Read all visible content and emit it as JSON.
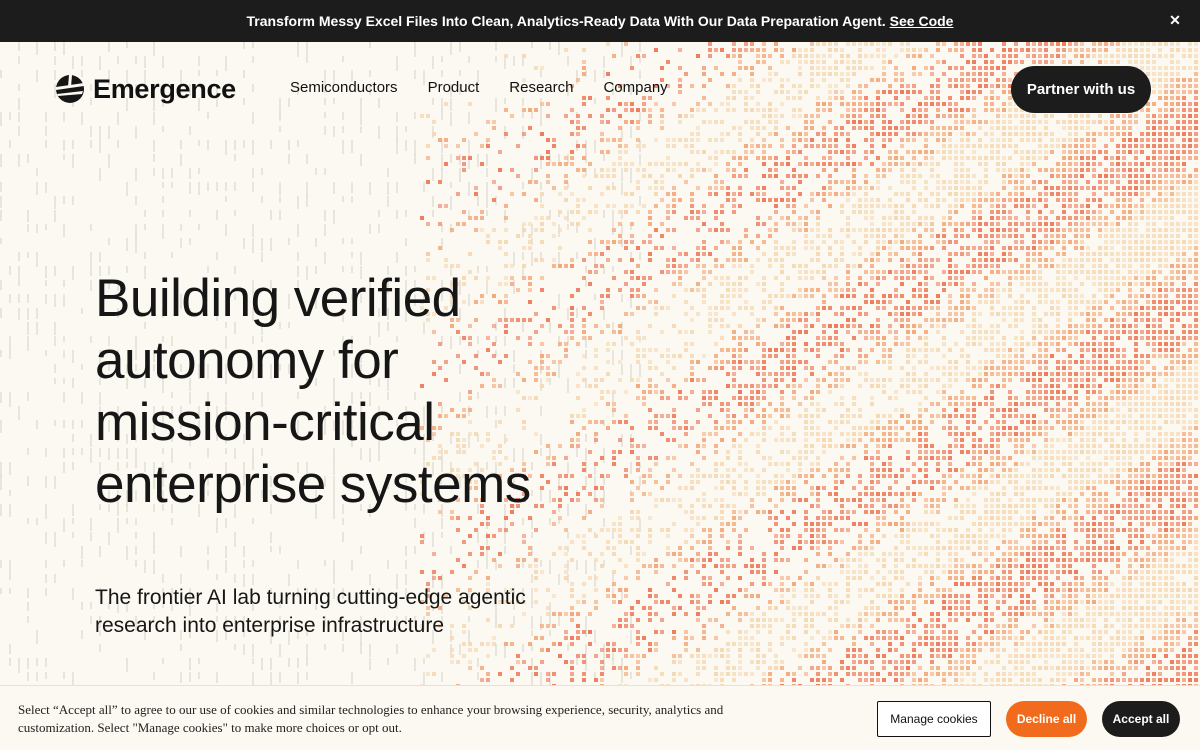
{
  "announcement": {
    "text": "Transform Messy Excel Files Into Clean, Analytics-Ready Data With Our Data Preparation Agent.",
    "link": "See Code",
    "close_icon": "close-icon"
  },
  "header": {
    "brand": "Emergence",
    "logo_icon": "emergence-logo-icon",
    "nav": [
      "Semiconductors",
      "Product",
      "Research",
      "Company"
    ],
    "cta": "Partner with us"
  },
  "hero": {
    "headline_lines": [
      "Building verified",
      "autonomy for",
      "mission-critical",
      "enterprise systems"
    ],
    "subheadline": "The frontier AI lab turning cutting-edge agentic research into enterprise infrastructure"
  },
  "cookie": {
    "text": "Select “Accept all” to agree to our use of cookies and similar technologies to enhance your browsing experience, security, analytics and customization. Select \"Manage cookies\" to make more choices or opt out.",
    "manage": "Manage cookies",
    "decline": "Decline all",
    "accept": "Accept all"
  },
  "colors": {
    "dark": "#1c1c1c",
    "background": "#fbf9f1",
    "accent_orange": "#f26b1d",
    "art_pale": "#f6d9b4",
    "art_mid": "#f4a97c",
    "art_strong": "#ee7c5c"
  }
}
